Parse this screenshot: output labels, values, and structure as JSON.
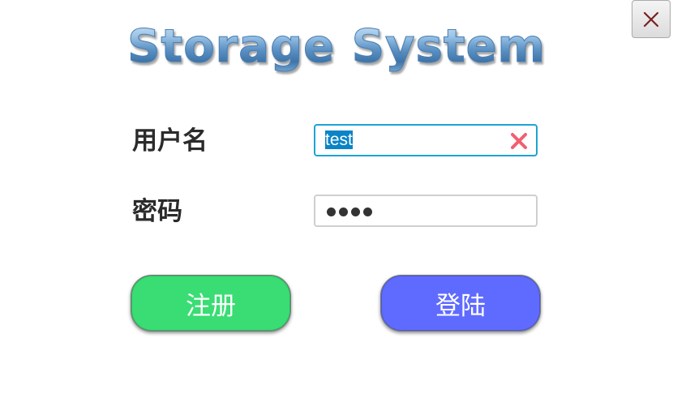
{
  "window": {
    "title": "Storage System"
  },
  "form": {
    "username_label": "用户名",
    "username_value": "test",
    "password_label": "密码",
    "password_dots": 4
  },
  "buttons": {
    "register_label": "注册",
    "login_label": "登陆"
  },
  "icons": {
    "close": "close-icon",
    "clear": "clear-icon"
  },
  "colors": {
    "register_button": "#39dd73",
    "login_button": "#5f6bff",
    "input_focus_border": "#1ea3d6",
    "clear_icon": "#f06070"
  }
}
